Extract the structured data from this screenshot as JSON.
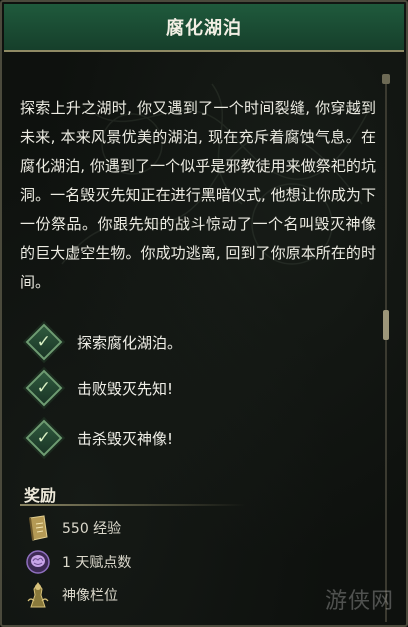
{
  "window": {
    "title": "腐化湖泊"
  },
  "description": "探索上升之湖时, 你又遇到了一个时间裂缝, 你穿越到未来, 本来风景优美的湖泊, 现在充斥着腐蚀气息。在腐化湖泊, 你遇到了一个似乎是邪教徒用来做祭祀的坑洞。一名毁灭先知正在进行黑暗仪式, 他想让你成为下一份祭品。你跟先知的战斗惊动了一个名叫毁灭神像的巨大虚空生物。你成功逃离, 回到了你原本所在的时间。",
  "objectives": [
    {
      "label": "探索腐化湖泊。",
      "completed": true,
      "icon": "check-icon"
    },
    {
      "label": "击败毁灭先知!",
      "completed": true,
      "icon": "check-icon"
    },
    {
      "label": "击杀毁灭神像!",
      "completed": true,
      "icon": "check-icon"
    }
  ],
  "rewards": {
    "title": "奖励",
    "items": [
      {
        "label": "550 经验",
        "icon": "experience-tome-icon"
      },
      {
        "label": "1 天赋点数",
        "icon": "brain-talent-icon"
      },
      {
        "label": "神像栏位",
        "icon": "idol-slot-icon"
      }
    ]
  },
  "watermark": "游侠网",
  "colors": {
    "header": "#1f5a3c",
    "accent_gold": "#8f8a64",
    "check_green": "#6e9c72"
  }
}
